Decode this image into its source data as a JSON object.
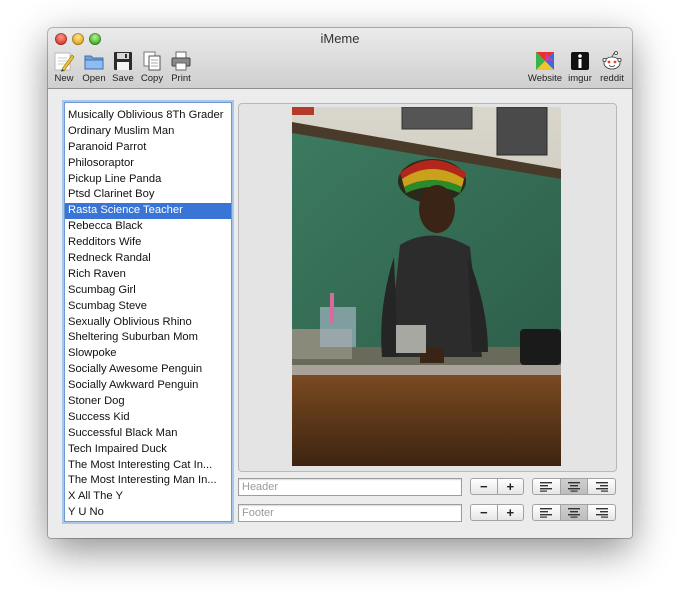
{
  "window": {
    "title": "iMeme"
  },
  "toolbar": {
    "left": [
      {
        "label": "New",
        "icon": "pencil-icon"
      },
      {
        "label": "Open",
        "icon": "folder-icon"
      },
      {
        "label": "Save",
        "icon": "floppy-disk-icon"
      },
      {
        "label": "Copy",
        "icon": "copy-documents-icon"
      },
      {
        "label": "Print",
        "icon": "printer-icon"
      }
    ],
    "right": [
      {
        "label": "Website",
        "icon": "colorful-square-icon"
      },
      {
        "label": "imgur",
        "icon": "imgur-icon"
      },
      {
        "label": "reddit",
        "icon": "reddit-alien-icon"
      }
    ]
  },
  "meme_list": {
    "selected": "Rasta Science Teacher",
    "items": [
      "Musically Oblivious 8Th Grader",
      "Ordinary Muslim Man",
      "Paranoid Parrot",
      "Philosoraptor",
      "Pickup Line Panda",
      "Ptsd Clarinet Boy",
      "Rasta Science Teacher",
      "Rebecca Black",
      "Redditors Wife",
      "Redneck Randal",
      "Rich Raven",
      "Scumbag Girl",
      "Scumbag Steve",
      "Sexually Oblivious Rhino",
      "Sheltering Suburban Mom",
      "Slowpoke",
      "Socially Awesome Penguin",
      "Socially Awkward Penguin",
      "Stoner Dog",
      "Success Kid",
      "Successful Black Man",
      "Tech Impaired Duck",
      "The Most Interesting Cat In...",
      "The Most Interesting Man In...",
      "X All The Y",
      "Y U No"
    ]
  },
  "editor": {
    "header": {
      "value": "",
      "placeholder": "Header",
      "size_minus": "−",
      "size_plus": "+",
      "alignment": "center"
    },
    "footer": {
      "value": "",
      "placeholder": "Footer",
      "size_minus": "−",
      "size_plus": "+",
      "alignment": "center"
    }
  }
}
